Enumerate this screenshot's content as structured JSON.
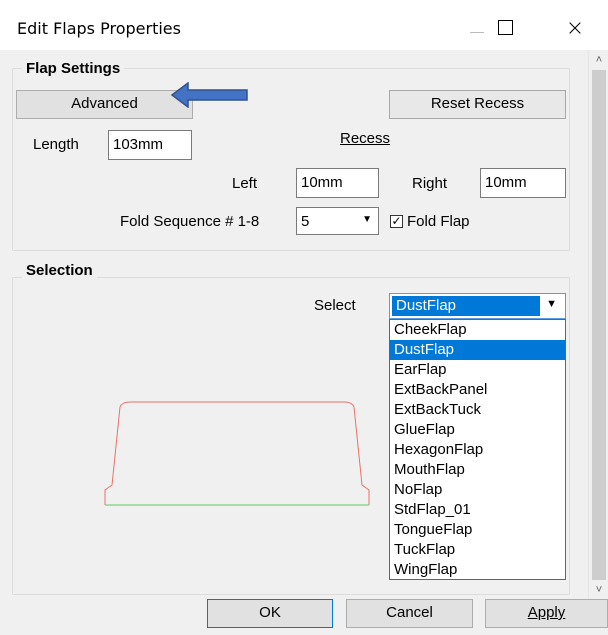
{
  "window": {
    "title": "Edit Flaps Properties",
    "close_glyph": "×"
  },
  "flap_settings": {
    "legend": "Flap Settings",
    "advanced_label": "Advanced",
    "reset_recess_label": "Reset Recess",
    "length_label": "Length",
    "length_value": "103mm",
    "recess_label": "Recess",
    "left_label": "Left",
    "left_value": "10mm",
    "right_label": "Right",
    "right_value": "10mm",
    "fold_sequence_label": "Fold Sequence # 1-8",
    "fold_sequence_value": "5",
    "fold_flap_label": "Fold Flap",
    "fold_flap_checked": true
  },
  "selection": {
    "legend": "Selection",
    "select_label": "Select",
    "selected_value": "DustFlap",
    "options": [
      "CheekFlap",
      "DustFlap",
      "EarFlap",
      "ExtBackPanel",
      "ExtBackTuck",
      "GlueFlap",
      "HexagonFlap",
      "MouthFlap",
      "NoFlap",
      "StdFlap_01",
      "TongueFlap",
      "TuckFlap",
      "WingFlap"
    ]
  },
  "footer": {
    "ok_label": "OK",
    "cancel_label": "Cancel",
    "apply_label": "Apply"
  },
  "colors": {
    "accent": "#0078d7",
    "arrow_fill": "#4472c4",
    "arrow_stroke": "#2f528f",
    "shape_outline": "#e8726a",
    "shape_baseline": "#7bd27b"
  },
  "icons": {
    "minimize": "minimize-icon",
    "maximize": "maximize-icon",
    "close": "close-icon",
    "dropdown": "chevron-down-icon",
    "scroll_up": "scroll-up-icon",
    "scroll_down": "scroll-down-icon",
    "pointer_arrow": "left-arrow-icon"
  }
}
